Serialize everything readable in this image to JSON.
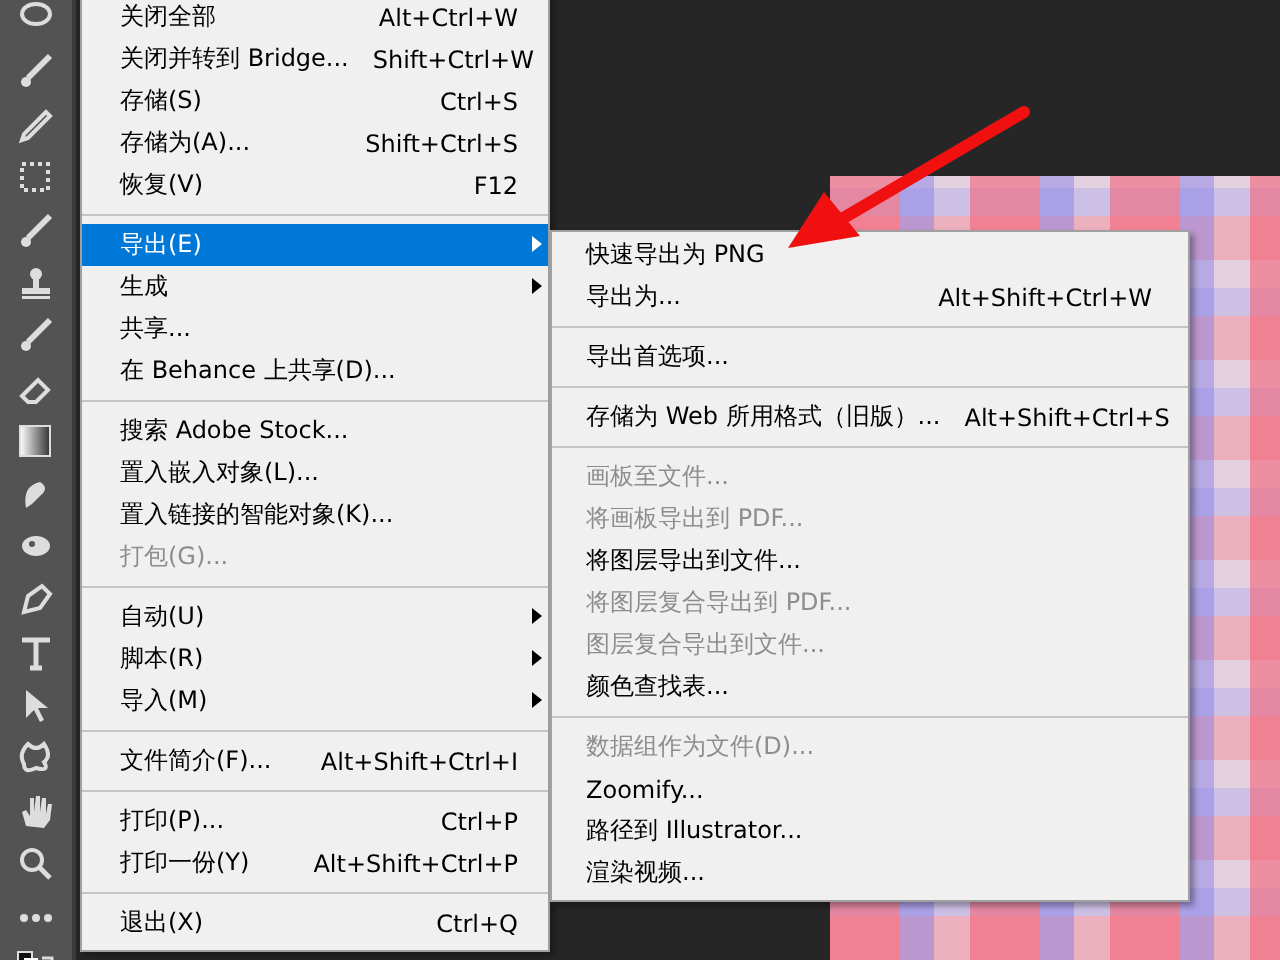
{
  "file_menu": {
    "items": [
      {
        "kind": "item",
        "label": "关闭全部",
        "shortcut": "Alt+Ctrl+W",
        "disabled": false,
        "selected": false,
        "has_submenu": false
      },
      {
        "kind": "item",
        "label": "关闭并转到 Bridge...",
        "shortcut": "Shift+Ctrl+W",
        "disabled": false,
        "selected": false,
        "has_submenu": false
      },
      {
        "kind": "item",
        "label": "存储(S)",
        "shortcut": "Ctrl+S",
        "disabled": false,
        "selected": false,
        "has_submenu": false
      },
      {
        "kind": "item",
        "label": "存储为(A)...",
        "shortcut": "Shift+Ctrl+S",
        "disabled": false,
        "selected": false,
        "has_submenu": false
      },
      {
        "kind": "item",
        "label": "恢复(V)",
        "shortcut": "F12",
        "disabled": false,
        "selected": false,
        "has_submenu": false
      },
      {
        "kind": "separator"
      },
      {
        "kind": "item",
        "label": "导出(E)",
        "disabled": false,
        "selected": true,
        "has_submenu": true
      },
      {
        "kind": "item",
        "label": "生成",
        "disabled": false,
        "selected": false,
        "has_submenu": true
      },
      {
        "kind": "item",
        "label": "共享...",
        "disabled": false,
        "selected": false,
        "has_submenu": false
      },
      {
        "kind": "item",
        "label": "在 Behance 上共享(D)...",
        "disabled": false,
        "selected": false,
        "has_submenu": false
      },
      {
        "kind": "separator"
      },
      {
        "kind": "item",
        "label": "搜索 Adobe Stock...",
        "disabled": false,
        "selected": false,
        "has_submenu": false
      },
      {
        "kind": "item",
        "label": "置入嵌入对象(L)...",
        "disabled": false,
        "selected": false,
        "has_submenu": false
      },
      {
        "kind": "item",
        "label": "置入链接的智能对象(K)...",
        "disabled": false,
        "selected": false,
        "has_submenu": false
      },
      {
        "kind": "item",
        "label": "打包(G)...",
        "disabled": true,
        "selected": false,
        "has_submenu": false
      },
      {
        "kind": "separator"
      },
      {
        "kind": "item",
        "label": "自动(U)",
        "disabled": false,
        "selected": false,
        "has_submenu": true
      },
      {
        "kind": "item",
        "label": "脚本(R)",
        "disabled": false,
        "selected": false,
        "has_submenu": true
      },
      {
        "kind": "item",
        "label": "导入(M)",
        "disabled": false,
        "selected": false,
        "has_submenu": true
      },
      {
        "kind": "separator"
      },
      {
        "kind": "item",
        "label": "文件简介(F)...",
        "shortcut": "Alt+Shift+Ctrl+I",
        "disabled": false,
        "selected": false,
        "has_submenu": false
      },
      {
        "kind": "separator"
      },
      {
        "kind": "item",
        "label": "打印(P)...",
        "shortcut": "Ctrl+P",
        "disabled": false,
        "selected": false,
        "has_submenu": false
      },
      {
        "kind": "item",
        "label": "打印一份(Y)",
        "shortcut": "Alt+Shift+Ctrl+P",
        "disabled": false,
        "selected": false,
        "has_submenu": false
      },
      {
        "kind": "separator"
      },
      {
        "kind": "item",
        "label": "退出(X)",
        "shortcut": "Ctrl+Q",
        "disabled": false,
        "selected": false,
        "has_submenu": false
      }
    ]
  },
  "export_submenu": {
    "items": [
      {
        "kind": "item",
        "label": "快速导出为 PNG",
        "disabled": false,
        "selected": false,
        "has_submenu": false
      },
      {
        "kind": "item",
        "label": "导出为...",
        "shortcut": "Alt+Shift+Ctrl+W",
        "disabled": false,
        "selected": false,
        "has_submenu": false
      },
      {
        "kind": "separator"
      },
      {
        "kind": "item",
        "label": "导出首选项...",
        "disabled": false,
        "selected": false,
        "has_submenu": false
      },
      {
        "kind": "separator"
      },
      {
        "kind": "item",
        "label": "存储为 Web 所用格式（旧版）...",
        "shortcut": "Alt+Shift+Ctrl+S",
        "disabled": false,
        "selected": false,
        "has_submenu": false
      },
      {
        "kind": "separator"
      },
      {
        "kind": "item",
        "label": "画板至文件...",
        "disabled": true,
        "selected": false,
        "has_submenu": false
      },
      {
        "kind": "item",
        "label": "将画板导出到 PDF...",
        "disabled": true,
        "selected": false,
        "has_submenu": false
      },
      {
        "kind": "item",
        "label": "将图层导出到文件...",
        "disabled": false,
        "selected": false,
        "has_submenu": false
      },
      {
        "kind": "item",
        "label": "将图层复合导出到 PDF...",
        "disabled": true,
        "selected": false,
        "has_submenu": false
      },
      {
        "kind": "item",
        "label": "图层复合导出到文件...",
        "disabled": true,
        "selected": false,
        "has_submenu": false
      },
      {
        "kind": "item",
        "label": "颜色查找表...",
        "disabled": false,
        "selected": false,
        "has_submenu": false
      },
      {
        "kind": "separator"
      },
      {
        "kind": "item",
        "label": "数据组作为文件(D)...",
        "disabled": true,
        "selected": false,
        "has_submenu": false
      },
      {
        "kind": "item",
        "label": "Zoomify...",
        "disabled": false,
        "selected": false,
        "has_submenu": false
      },
      {
        "kind": "item",
        "label": "路径到 Illustrator...",
        "disabled": false,
        "selected": false,
        "has_submenu": false
      },
      {
        "kind": "item",
        "label": "渲染视频...",
        "disabled": false,
        "selected": false,
        "has_submenu": false
      }
    ]
  }
}
